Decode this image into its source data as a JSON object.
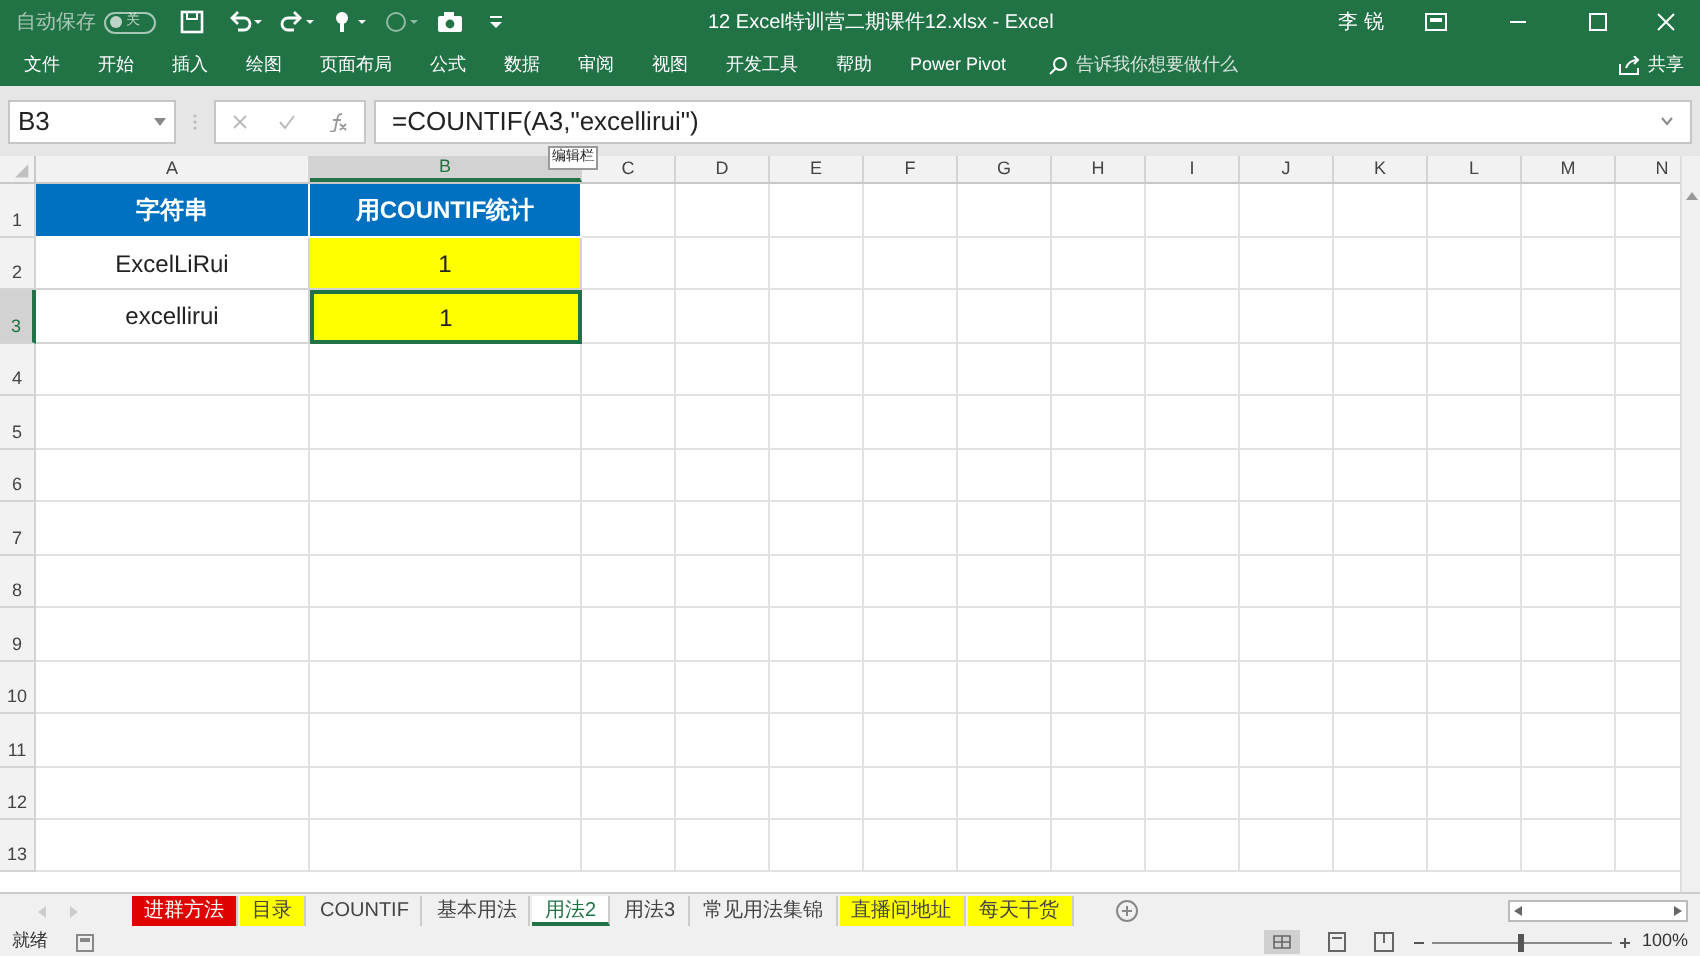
{
  "window": {
    "title": "12 Excel特训营二期课件12.xlsx  -  Excel",
    "user": "李 锐",
    "autosave": {
      "label": "自动保存",
      "state_label": "关",
      "on": false
    }
  },
  "ribbon": {
    "tabs": [
      "文件",
      "开始",
      "插入",
      "绘图",
      "页面布局",
      "公式",
      "数据",
      "审阅",
      "视图",
      "开发工具",
      "帮助",
      "Power Pivot"
    ],
    "search": {
      "placeholder": "告诉我你想要做什么"
    },
    "share": "共享"
  },
  "formula_bar": {
    "name_box": "B3",
    "formula": "=COUNTIF(A3,\"excellirui\")",
    "tooltip": "编辑栏"
  },
  "columns": [
    {
      "label": "A",
      "selected": false
    },
    {
      "label": "B",
      "selected": true
    },
    {
      "label": "C",
      "selected": false
    },
    {
      "label": "D",
      "selected": false
    },
    {
      "label": "E",
      "selected": false
    },
    {
      "label": "F",
      "selected": false
    },
    {
      "label": "G",
      "selected": false
    },
    {
      "label": "H",
      "selected": false
    },
    {
      "label": "I",
      "selected": false
    },
    {
      "label": "J",
      "selected": false
    },
    {
      "label": "K",
      "selected": false
    },
    {
      "label": "L",
      "selected": false
    },
    {
      "label": "M",
      "selected": false
    },
    {
      "label": "N",
      "selected": false
    }
  ],
  "rows": [
    {
      "label": "1",
      "selected": false,
      "cells": [
        {
          "text": "字符串",
          "kind": "header",
          "selected": false
        },
        {
          "text": "用COUNTIF统计",
          "kind": "header",
          "selected": false
        }
      ]
    },
    {
      "label": "2",
      "selected": false,
      "cells": [
        {
          "text": "ExcelLiRui",
          "kind": "plain",
          "selected": false
        },
        {
          "text": "1",
          "kind": "highlight",
          "selected": false
        }
      ]
    },
    {
      "label": "3",
      "selected": true,
      "cells": [
        {
          "text": "excellirui",
          "kind": "plain",
          "selected": false
        },
        {
          "text": "1",
          "kind": "highlight",
          "selected": true
        }
      ]
    },
    {
      "label": "4",
      "selected": false,
      "cells": []
    },
    {
      "label": "5",
      "selected": false,
      "cells": []
    },
    {
      "label": "6",
      "selected": false,
      "cells": []
    },
    {
      "label": "7",
      "selected": false,
      "cells": []
    },
    {
      "label": "8",
      "selected": false,
      "cells": []
    },
    {
      "label": "9",
      "selected": false,
      "cells": []
    },
    {
      "label": "10",
      "selected": false,
      "cells": []
    },
    {
      "label": "11",
      "selected": false,
      "cells": []
    },
    {
      "label": "12",
      "selected": false,
      "cells": []
    },
    {
      "label": "13",
      "selected": false,
      "cells": []
    }
  ],
  "sheet_tabs": [
    {
      "label": "进群方法",
      "color": "#e00000",
      "selected": false
    },
    {
      "label": "目录",
      "color": "#ffff00",
      "selected": false
    },
    {
      "label": "COUNTIF",
      "selected": false
    },
    {
      "label": "基本用法",
      "selected": false
    },
    {
      "label": "用法2",
      "selected": true
    },
    {
      "label": "用法3",
      "selected": false
    },
    {
      "label": "常见用法集锦",
      "selected": false
    },
    {
      "label": "直播间地址",
      "color": "#ffff00",
      "selected": false
    },
    {
      "label": "每天干货",
      "color": "#ffff00",
      "selected": false
    }
  ],
  "status_bar": {
    "status": "就绪",
    "zoom": {
      "level": 0.5,
      "reading": "100%"
    }
  }
}
